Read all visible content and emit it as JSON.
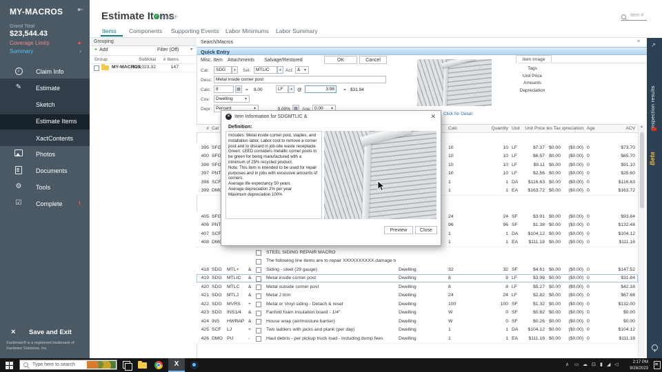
{
  "sidebar": {
    "title": "MY-MACROS",
    "grand_total_label": "Grand Total",
    "grand_total": "$23,544.43",
    "coverage_limits_label": "Coverage Limits",
    "summary_label": "Summary",
    "nav": [
      {
        "label": "Claim Info"
      },
      {
        "label": "Estimate"
      },
      {
        "label": "Sketch"
      },
      {
        "label": "Estimate Items"
      },
      {
        "label": "XactContents"
      },
      {
        "label": "Photos"
      },
      {
        "label": "Documents"
      },
      {
        "label": "Tools"
      },
      {
        "label": "Complete",
        "badge": "!"
      }
    ],
    "save_exit_label": "Save and Exit",
    "trademark": "Xactimate® is a registered trademark of Xactware Solutions, Inc."
  },
  "header": {
    "title": "Estimate Items",
    "saved_label": "Saved",
    "tabs": [
      "Items",
      "Components",
      "Supporting Events",
      "Labor Minimums",
      "Labor Summary"
    ],
    "item_search_placeholder": "Item #"
  },
  "grouping": {
    "title": "Grouping",
    "add_label": "Add",
    "filter_label": "Filter (Off)",
    "columns": [
      "Group",
      "Subtotal",
      "# Items"
    ],
    "row": {
      "group": "MY-MACROS",
      "subtotal": "$23,023.32",
      "items": "147"
    }
  },
  "quick_entry": {
    "section_search": "Search/Macros",
    "section_title": "Quick Entry",
    "tabs": [
      "Misc. Item",
      "Attachments",
      "Salvage/Restored"
    ],
    "ok_label": "OK",
    "cancel_label": "Cancel",
    "cat_label": "Cat:",
    "cat": "SDG",
    "sel_label": "Sel:",
    "sel": "MTLIC",
    "act_label": "Act:",
    "act": "&",
    "desc_label": "Desc:",
    "desc": "Metal inside corner post",
    "calc_label": "Calc:",
    "calc": "8",
    "equals": "=",
    "calc_total": "8.00",
    "unit": "LF",
    "at": "@",
    "rate": "3.98",
    "line_total": "$31.84",
    "cov_label": "Cov:",
    "cov": "Dwelling",
    "depr_label": "Depr:",
    "depr_type": "Percent",
    "depr_pct": "0.00%",
    "age_label": "Age:",
    "age": "0.00"
  },
  "item_panel": {
    "tab_label": "Item Image",
    "links": [
      "Tags",
      "Unit Price",
      "Amounts",
      "Depreciation"
    ],
    "detail_link": "Click for Detail"
  },
  "modal": {
    "title": "Item Information for SDGMTLIC &",
    "definition_label": "Definition:",
    "definition": [
      "Includes: Metal inside corner post, staples, and installation labor.  Labor cost to remove a corner post and to discard in job-site waste receptacle.",
      "Green: LEED considers metallic corner posts to be green for being manufactured with a minimum of 25% recycled product.",
      "Note: This item is intended to be used for repair purposes and in jobs with excessive amounts of corners.",
      "Average life expectancy 50 years",
      "Average depreciation 2% per year",
      "Maximum depreciation 100%"
    ],
    "preview_label": "Preview",
    "close_label": "Close"
  },
  "table": {
    "headers": {
      "num": "#",
      "cat": "Cat",
      "calc": "Calc",
      "qty": "Quantity",
      "unit": "Unit",
      "price": "Unit Price",
      "tax": "Sales Tax",
      "depr": "Depreciation",
      "age": "Age",
      "acv": "ACV"
    },
    "rows_top": [
      {
        "num": "395",
        "cat": "SFG",
        "calc": "10",
        "qty": "10",
        "unit": "LF",
        "price": "$7.37",
        "tax": "$0.00",
        "depr": "($0.00)",
        "age": "0",
        "acv": "$73.70"
      },
      {
        "num": "400",
        "cat": "SFG",
        "calc": "10",
        "qty": "10",
        "unit": "LF",
        "price": "$6.57",
        "tax": "$0.00",
        "depr": "($0.00)",
        "age": "0",
        "acv": "$65.70"
      },
      {
        "num": "396",
        "cat": "SFG",
        "calc": "10",
        "qty": "10",
        "unit": "LF",
        "price": "$9.11",
        "tax": "$0.00",
        "depr": "($0.00)",
        "age": "0",
        "acv": "$91.10"
      },
      {
        "num": "397",
        "cat": "PNT",
        "calc": "10",
        "qty": "10",
        "unit": "LF",
        "price": "$2.56",
        "tax": "$0.00",
        "depr": "($0.00)",
        "age": "0",
        "acv": "$25.60"
      },
      {
        "num": "398",
        "cat": "SCF",
        "calc": "1",
        "qty": "1",
        "unit": "DA",
        "price": "$116.63",
        "tax": "$0.00",
        "depr": "($0.00)",
        "age": "0",
        "acv": "$116.63"
      },
      {
        "num": "399",
        "cat": "DMO",
        "calc": "1",
        "qty": "1",
        "unit": "EA",
        "price": "$163.72",
        "tax": "$0.00",
        "depr": "($0.00)",
        "age": "0",
        "acv": "$163.72"
      },
      {
        "num": "405",
        "cat": "SFG",
        "calc": "24",
        "qty": "24",
        "unit": "SF",
        "price": "$3.91",
        "tax": "$0.00",
        "depr": "($0.00)",
        "age": "0",
        "acv": "$93.84"
      },
      {
        "num": "406",
        "cat": "PNT",
        "calc": "96",
        "qty": "96",
        "unit": "SF",
        "price": "$1.38",
        "tax": "$0.00",
        "depr": "($0.00)",
        "age": "0",
        "acv": "$132.48"
      },
      {
        "num": "407",
        "cat": "SCF",
        "calc": "1",
        "qty": "1",
        "unit": "DA",
        "price": "$104.12",
        "tax": "$0.00",
        "depr": "($0.00)",
        "age": "0",
        "acv": "$104.12"
      },
      {
        "num": "408",
        "cat": "DMO",
        "calc": "1",
        "qty": "1",
        "unit": "EA",
        "price": "$111.18",
        "tax": "$0.00",
        "depr": "($0.00)",
        "age": "0",
        "acv": "$111.18"
      }
    ],
    "macro_rows": [
      {
        "desc": "STEEL SIDING REPAIR MACRO"
      },
      {
        "desc": "The following line items are to repair XXXXXXXXXX damage to the stee"
      }
    ],
    "rows_bottom": [
      {
        "num": "418",
        "cat": "SDG",
        "sel": "MTL+",
        "act": "&",
        "desc": "Siding - steel (29 gauge)",
        "cov": "Dwelling",
        "calc": "32",
        "qty": "32",
        "unit": "SF",
        "price": "$4.61",
        "tax": "$0.00",
        "depr": "($0.00)",
        "age": "0",
        "acv": "$147.52"
      },
      {
        "num": "419",
        "cat": "SDG",
        "sel": "MTLIC",
        "act": "&",
        "desc": "Metal inside corner post",
        "cov": "Dwelling",
        "calc": "8",
        "qty": "8",
        "unit": "LF",
        "price": "$3.98",
        "tax": "$0.00",
        "depr": "($0.00)",
        "age": "0",
        "acv": "$31.84",
        "selected": true
      },
      {
        "num": "420",
        "cat": "SDG",
        "sel": "MTLC",
        "act": "&",
        "desc": "Metal outside corner post",
        "cov": "Dwelling",
        "calc": "8",
        "qty": "8",
        "unit": "LF",
        "price": "$5.27",
        "tax": "$0.00",
        "depr": "($0.00)",
        "age": "0",
        "acv": "$42.16"
      },
      {
        "num": "421",
        "cat": "SDG",
        "sel": "MTLJ",
        "act": "&",
        "desc": "Metal J trim",
        "cov": "Dwelling",
        "calc": "24",
        "qty": "24",
        "unit": "LF",
        "price": "$2.82",
        "tax": "$0.00",
        "depr": "($0.00)",
        "age": "0",
        "acv": "$67.68"
      },
      {
        "num": "422",
        "cat": "SDG",
        "sel": "MVRS",
        "act": "+",
        "desc": "Metal or Vinyl siding - Detach & reset",
        "cov": "Dwelling",
        "calc": "100",
        "qty": "100",
        "unit": "SF",
        "price": "$1.32",
        "tax": "$0.00",
        "depr": "($0.00)",
        "age": "0",
        "acv": "$132.00"
      },
      {
        "num": "423",
        "cat": "SDG",
        "sel": "INS1/4",
        "act": "&",
        "desc": "Fanfold foam insulation board - 1/4\"",
        "cov": "Dwelling",
        "calc": "W",
        "qty": "0",
        "unit": "SF",
        "price": "$0.62",
        "tax": "$0.00",
        "depr": "($0.00)",
        "age": "0",
        "acv": "$0.00"
      },
      {
        "num": "424",
        "cat": "INS",
        "sel": "HWRAP",
        "act": "&",
        "desc": "House wrap (air/moisture barrier)",
        "cov": "Dwelling",
        "calc": "W",
        "qty": "0",
        "unit": "SF",
        "price": "$0.26",
        "tax": "$0.00",
        "depr": "($0.00)",
        "age": "0",
        "acv": "$0.00"
      },
      {
        "num": "425",
        "cat": "SCF",
        "sel": "LJ",
        "act": "+",
        "desc": "Two ladders with jacks and plank (per day)",
        "cov": "Dwelling",
        "calc": "1",
        "qty": "1",
        "unit": "DA",
        "price": "$104.12",
        "tax": "$0.00",
        "depr": "($0.00)",
        "age": "0",
        "acv": "$104.12"
      },
      {
        "num": "426",
        "cat": "DMO",
        "sel": "PU",
        "act": "-",
        "desc": "Haul debris - per pickup truck load - including dump fees",
        "cov": "Dwelling",
        "calc": "1",
        "qty": "1",
        "unit": "EA",
        "price": "$111.18",
        "tax": "$0.00",
        "depr": "($0.00)",
        "age": "0",
        "acv": "$111.18"
      }
    ]
  },
  "right_strip": {
    "inspection_label": "Inspection results",
    "beta_label": "Beta"
  },
  "taskbar": {
    "search_placeholder": "Type here to search",
    "time": "2:17 PM",
    "date": "9/28/2023"
  },
  "colors": {
    "accent_yellow": "#f2c200",
    "tab_teal": "#0e7c86",
    "warning_red": "#ef5350",
    "summary_cyan": "#56c5ef",
    "beta_yellow": "#e8b73a",
    "quick_entry_blue": "#b4d4ec"
  }
}
